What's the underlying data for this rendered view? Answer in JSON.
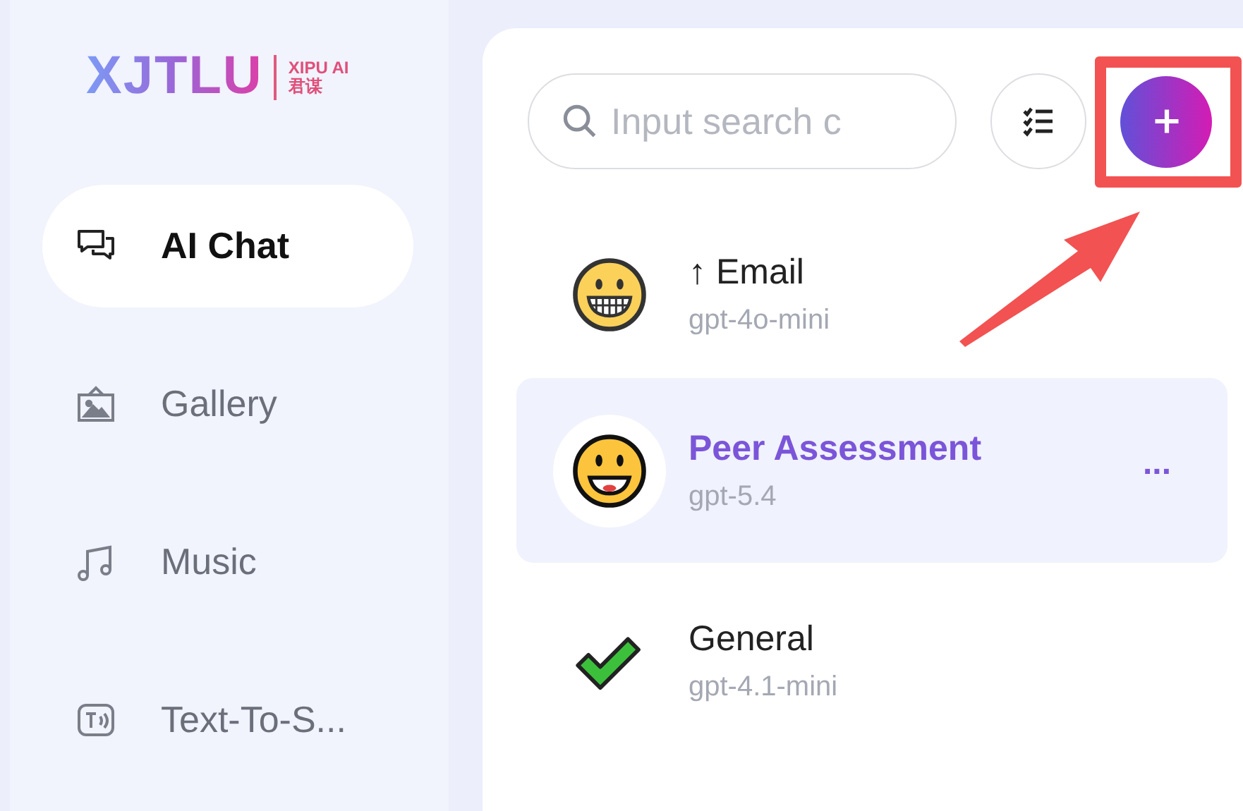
{
  "logo": {
    "wordmark": "XJTLU",
    "sub_top": "XIPU AI",
    "sub_bottom": "君谋"
  },
  "sidebar": {
    "items": [
      {
        "kind": "chat",
        "label": "AI Chat",
        "selected": true
      },
      {
        "kind": "gallery",
        "label": "Gallery",
        "selected": false
      },
      {
        "kind": "music",
        "label": "Music",
        "selected": false
      },
      {
        "kind": "speech",
        "label": "Text-To-S...",
        "selected": false
      }
    ]
  },
  "search": {
    "placeholder": "Input search c"
  },
  "chats": [
    {
      "kind": "grin",
      "title": "↑ Email",
      "model": "gpt-4o-mini",
      "selected": false
    },
    {
      "kind": "smile",
      "title": "Peer Assessment",
      "model": "gpt-5.4",
      "selected": true,
      "more": "..."
    },
    {
      "kind": "check",
      "title": "General",
      "model": "gpt-4.1-mini",
      "selected": false
    }
  ]
}
